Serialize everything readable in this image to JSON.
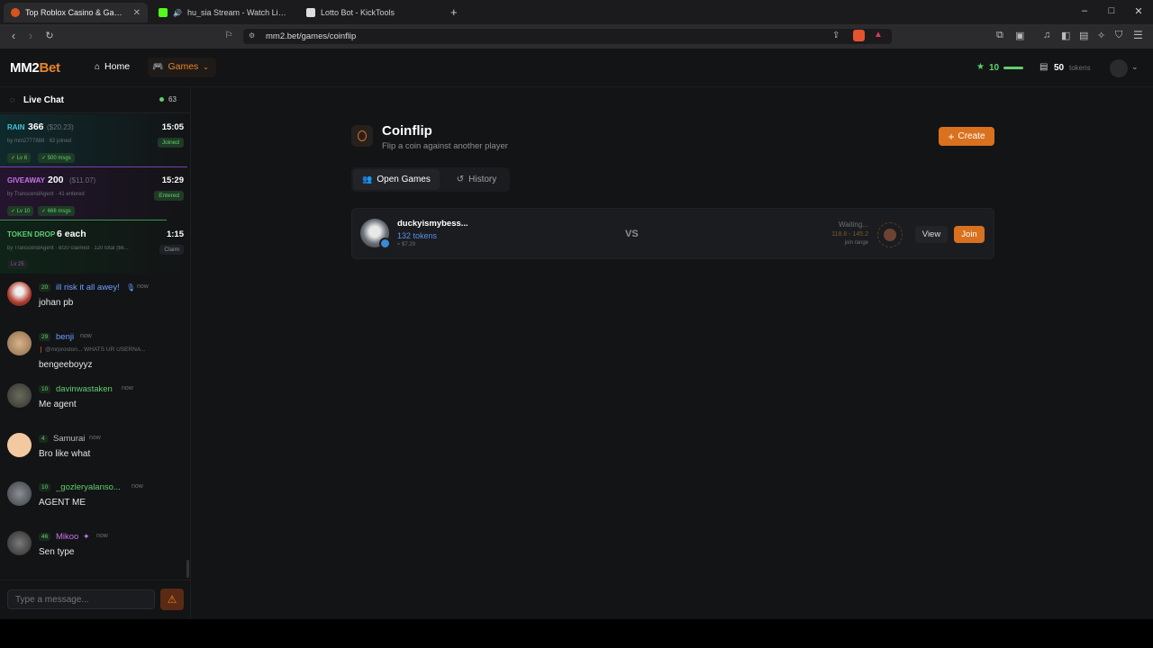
{
  "browser": {
    "tabs": [
      {
        "title": "Top Roblox Casino & Gambling",
        "active": true
      },
      {
        "title": "hu_sia Stream - Watch Live on Ki",
        "active": false
      },
      {
        "title": "Lotto Bot - KickTools",
        "active": false
      }
    ],
    "new_tab": "+",
    "url": "mm2.bet/games/coinflip",
    "window_controls": {
      "minimize": "–",
      "maximize": "□",
      "close": "✕"
    }
  },
  "site": {
    "logo_main": "MM2",
    "logo_accent": "Bet",
    "nav": {
      "home": "Home",
      "games": "Games"
    },
    "user": {
      "level": "10",
      "tokens": "50",
      "tokens_label": "tokens"
    }
  },
  "chat": {
    "title": "Live Chat",
    "online": "63",
    "rain": {
      "label": "RAIN",
      "amount": "366",
      "usd": "($20.23)",
      "time": "15:05",
      "by": "by mm2777888 · 62 joined",
      "status": "Joined",
      "tags": [
        "✓ Lv 6",
        "✓ 500 msgs"
      ]
    },
    "giveaway": {
      "label": "GIVEAWAY",
      "amount": "200",
      "usd": "($11.07)",
      "time": "15:29",
      "by": "by TranscendAgent · 41 entered",
      "status": "Entered",
      "tags": [
        "✓ Lv 10",
        "✓ 666 msgs"
      ]
    },
    "token_drop": {
      "label": "TOKEN DROP",
      "amount": "6 each",
      "time": "1:15",
      "by": "by TranscendAgent · 8/20 claimed · 120 total ($6...",
      "status": "Claim",
      "tags": [
        "Lv 25"
      ]
    },
    "messages": [
      {
        "level": "20",
        "name": "ill risk it all awey!",
        "time": "now",
        "text": "johan pb",
        "name_color": "#6aa0ff"
      },
      {
        "level": "29",
        "name": "benji",
        "time": "now",
        "reply": "@mrproston... WHATS UR USERNA...",
        "text": "bengeeboyyz",
        "name_color": "#6aa0ff"
      },
      {
        "level": "10",
        "name": "davinwastaken",
        "time": "now",
        "text": "Me agent",
        "name_color": "#5fd06f"
      },
      {
        "level": "4",
        "name": "Samurai",
        "time": "now",
        "text": "Bro like what",
        "name_color": "#bbbbbb"
      },
      {
        "level": "10",
        "name": "_gozleryalanso...",
        "time": "now",
        "text": "AGENT ME",
        "name_color": "#5fd06f"
      },
      {
        "level": "46",
        "name": "Mikoo",
        "time": "now",
        "text": "Sen type",
        "name_color": "#c774e8"
      }
    ],
    "input_placeholder": "Type a message..."
  },
  "main": {
    "title": "Coinflip",
    "subtitle": "Flip a coin against another player",
    "create_label": "Create",
    "tabs": {
      "open": "Open Games",
      "history": "History"
    },
    "game": {
      "player": "duckyismybess...",
      "tokens": "132 tokens",
      "usd": "≈ $7.29",
      "vs": "VS",
      "status": "Waiting...",
      "range": "118.8 - 145.2",
      "range_label": "join range",
      "view_label": "View",
      "join_label": "Join"
    }
  }
}
